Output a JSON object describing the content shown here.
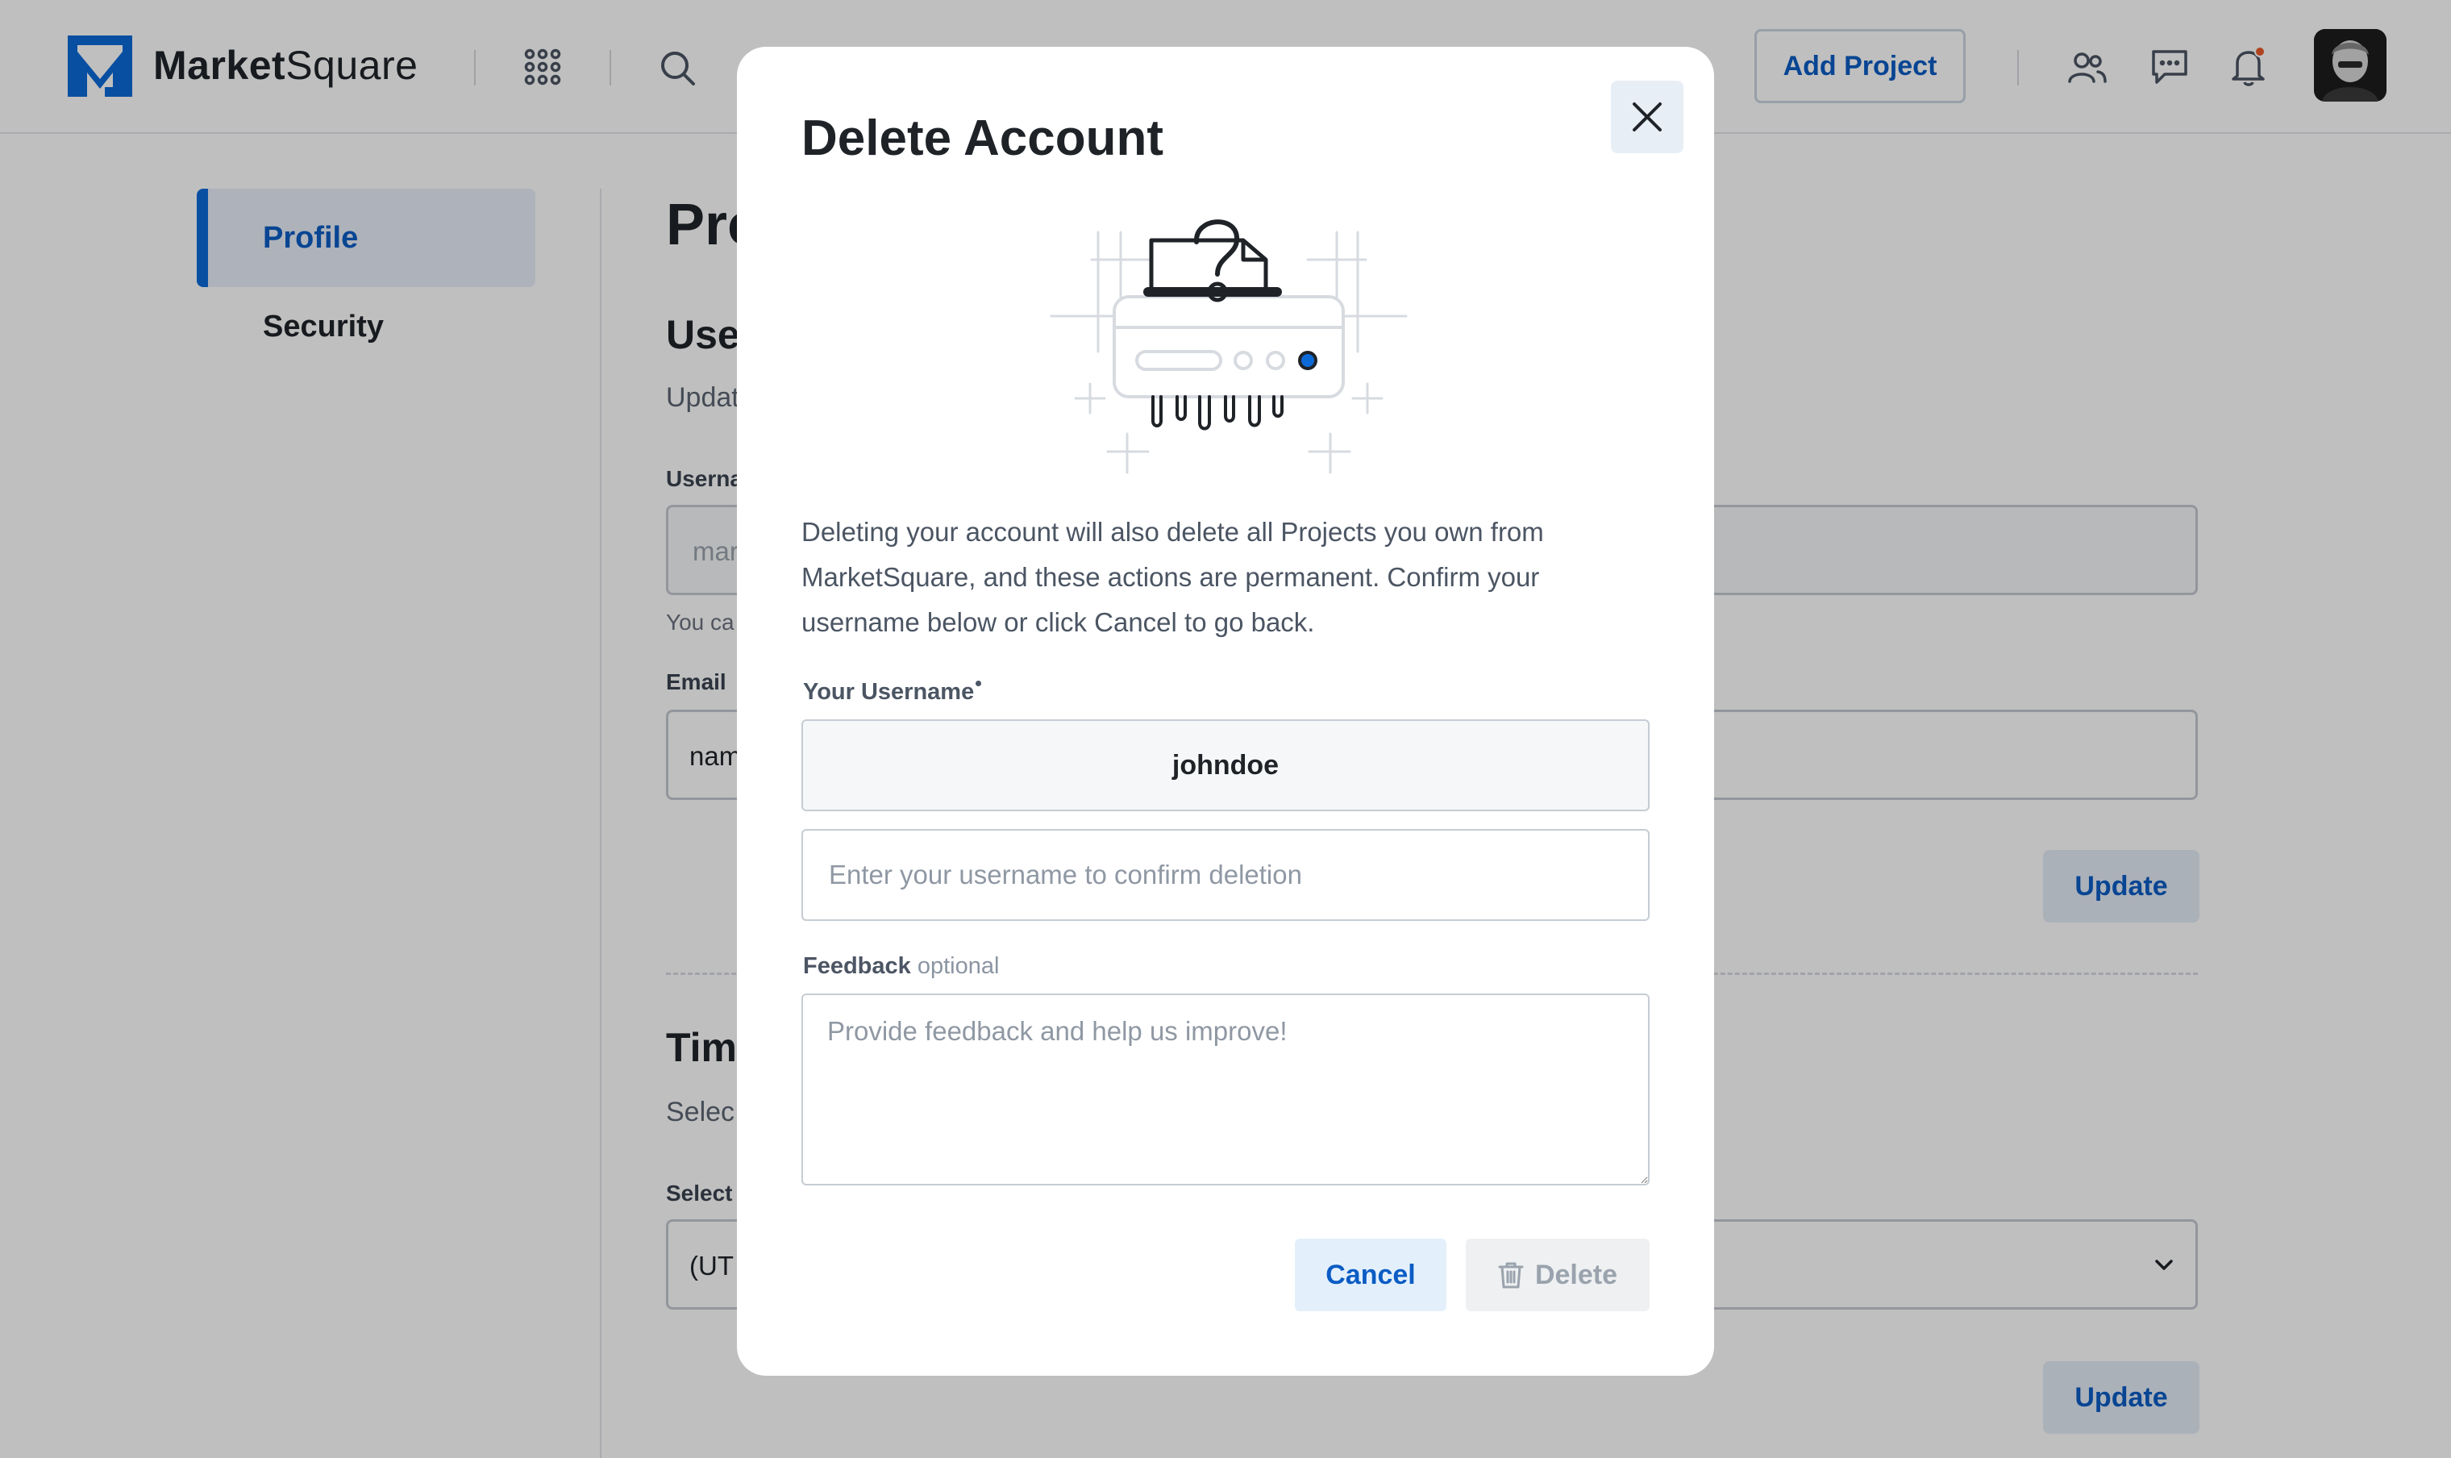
{
  "header": {
    "brand_bold": "Market",
    "brand_light": "Square",
    "add_project_label": "Add Project",
    "icons": [
      "apps-grid-icon",
      "search-icon",
      "users-icon",
      "chat-icon",
      "bell-icon"
    ],
    "notification_dot_color": "#e85a2c"
  },
  "sidebar": {
    "items": [
      {
        "label": "Profile",
        "active": true
      },
      {
        "label": "Security",
        "active": false
      }
    ]
  },
  "page": {
    "title_partial": "Pro",
    "username_section": {
      "title_partial": "Use",
      "description_partial": "Updat",
      "username_label_partial": "Userna",
      "username_value_partial": "mar",
      "hint_partial": "You ca",
      "email_label": "Email",
      "email_value_partial": "nam",
      "update_label": "Update"
    },
    "timezone_section": {
      "title_partial": "Tim",
      "description_partial": "Selec",
      "select_label_partial": "Select",
      "select_value_partial": "(UT",
      "update_label": "Update"
    }
  },
  "modal": {
    "title": "Delete Account",
    "description": "Deleting your account will also delete all Projects you own from MarketSquare, and these actions are permanent. Confirm your username below or click Cancel to go back.",
    "username_label": "Your Username",
    "username_value": "johndoe",
    "confirm_placeholder": "Enter your username to confirm deletion",
    "feedback_label": "Feedback",
    "feedback_optional": "optional",
    "feedback_placeholder": "Provide feedback and help us improve!",
    "cancel_label": "Cancel",
    "delete_label": "Delete",
    "accent_color": "#0b6ad8"
  }
}
